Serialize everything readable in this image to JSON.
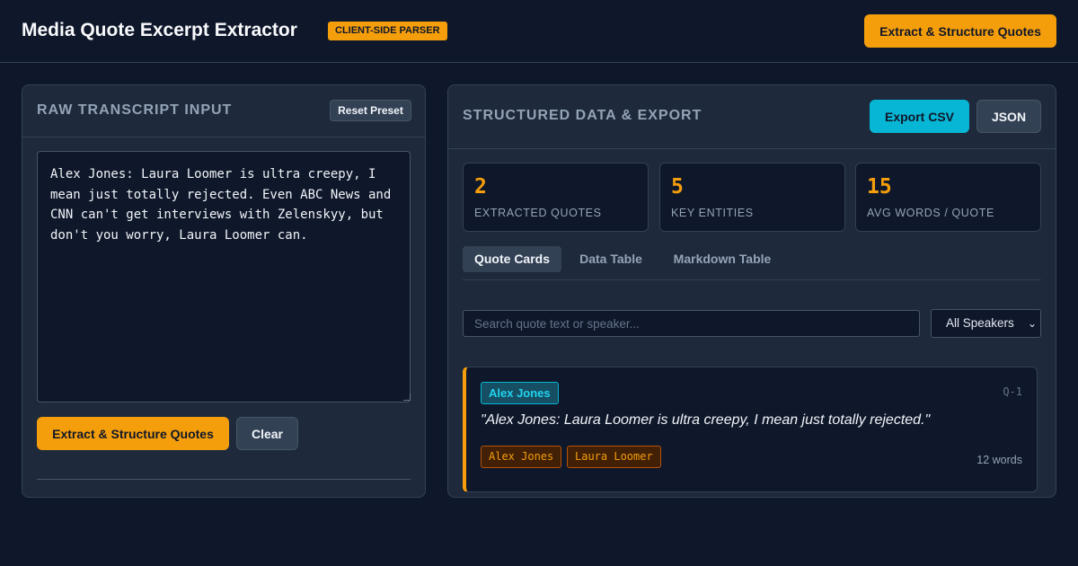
{
  "header": {
    "title": "Media Quote Excerpt Extractor",
    "badge": "CLIENT-SIDE PARSER",
    "extract_label": "Extract & Structure Quotes"
  },
  "input_panel": {
    "title": "RAW TRANSCRIPT INPUT",
    "reset_label": "Reset Preset",
    "transcript": "Alex Jones: Laura Loomer is ultra creepy, I mean just totally rejected. Even ABC News and CNN can't get interviews with Zelenskyy, but don't you worry, Laura Loomer can.",
    "extract_label": "Extract & Structure Quotes",
    "clear_label": "Clear"
  },
  "output_panel": {
    "title": "STRUCTURED DATA & EXPORT",
    "export_csv_label": "Export CSV",
    "json_label": "JSON",
    "stats": [
      {
        "value": "2",
        "label": "EXTRACTED QUOTES"
      },
      {
        "value": "5",
        "label": "KEY ENTITIES"
      },
      {
        "value": "15",
        "label": "AVG WORDS / QUOTE"
      }
    ],
    "tabs": [
      {
        "label": "Quote Cards",
        "active": true
      },
      {
        "label": "Data Table",
        "active": false
      },
      {
        "label": "Markdown Table",
        "active": false
      }
    ],
    "search_placeholder": "Search quote text or speaker...",
    "speaker_filter": "All Speakers",
    "quote_card": {
      "speaker": "Alex Jones",
      "id": "Q-1",
      "text": "\"Alex Jones: Laura Loomer is ultra creepy, I mean just totally rejected.\"",
      "entities": [
        "Alex Jones",
        "Laura Loomer"
      ],
      "word_count": "12 words"
    }
  },
  "colors": {
    "background": "#0f172a",
    "panel": "#1e293b",
    "accent": "#f59e0b",
    "accent_secondary": "#06b6d4"
  }
}
